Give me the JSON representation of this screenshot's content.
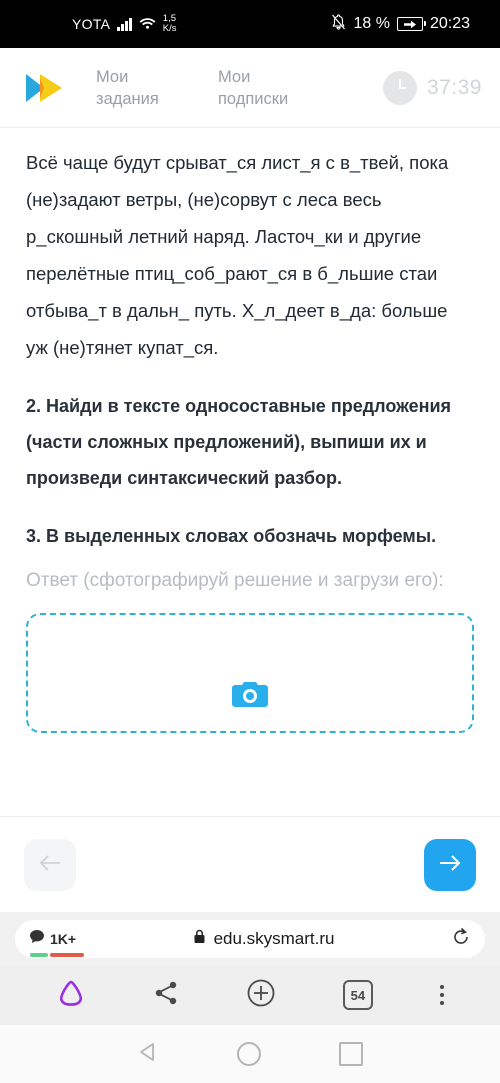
{
  "status_bar": {
    "carrier": "YOTA",
    "signal_icon": "signal-bars-icon",
    "wifi_icon": "wifi-icon",
    "net_speed_value": "1,5",
    "net_speed_unit": "K/s",
    "mute_icon": "bell-muted-icon",
    "battery_percent": "18 %",
    "battery_icon": "battery-charging-icon",
    "time": "20:23",
    "background": "#000000"
  },
  "app_header": {
    "logo_icon": "skysmart-play-logo",
    "logo_colors": {
      "blue": "#2ba6dd",
      "yellow": "#f5cd19",
      "orange": "#f7931e"
    },
    "tabs": [
      {
        "label": "Мои задания",
        "name": "tab-my-assignments"
      },
      {
        "label": "Мои подписки",
        "name": "tab-my-subscriptions"
      }
    ],
    "timer": {
      "icon": "clock-icon",
      "value": "37:39"
    }
  },
  "content": {
    "paragraph": "Всё чаще будут срыват_ся лист_я с в_твей, пока (не)задают ветры, (не)сорвут с леса весь р_скошный летний наряд. Ласточ_ки и другие перелётные птиц_соб_рают_ся в б_льшие стаи отбыва_т в дальн_ путь. Х_л_деет в_да: больше уж (не)тянет купат_ся.",
    "task_2": "2. Найди в тексте односоставные предложения (части сложных предложений), выпиши их и произведи синтаксический разбор.",
    "task_3": "3. В выделенных словах обозначь морфемы.",
    "answer_label": "Ответ (сфотографируй решение и загрузи его):",
    "upload": {
      "icon": "camera-icon",
      "border_color": "#2eb2d4"
    }
  },
  "nav": {
    "prev": {
      "icon": "arrow-left-icon",
      "label": "Назад",
      "enabled": false,
      "background": "#f4f5f6"
    },
    "next": {
      "icon": "arrow-right-icon",
      "label": "Далее",
      "enabled": true,
      "background": "#22a5ef"
    }
  },
  "browser": {
    "comments_badge": {
      "icon": "comment-icon",
      "count": "1K+"
    },
    "lock_icon": "lock-icon",
    "url": "edu.skysmart.ru",
    "reload_icon": "reload-icon",
    "toolbar": [
      {
        "name": "alice-assistant-icon",
        "label": "Алиса",
        "color": "#9b30e0"
      },
      {
        "name": "share-icon",
        "label": "Поделиться",
        "color": "#4a4a4a"
      },
      {
        "name": "add-tab-icon",
        "label": "Новая вкладка",
        "color": "#4a4a4a"
      },
      {
        "name": "tab-count-button",
        "label": "54",
        "color": "#4a4a4a"
      },
      {
        "name": "more-menu-icon",
        "label": "Меню",
        "color": "#4a4a4a"
      }
    ]
  },
  "android_nav": {
    "back_icon": "android-back-icon",
    "home_icon": "android-home-icon",
    "recents_icon": "android-recents-icon"
  }
}
